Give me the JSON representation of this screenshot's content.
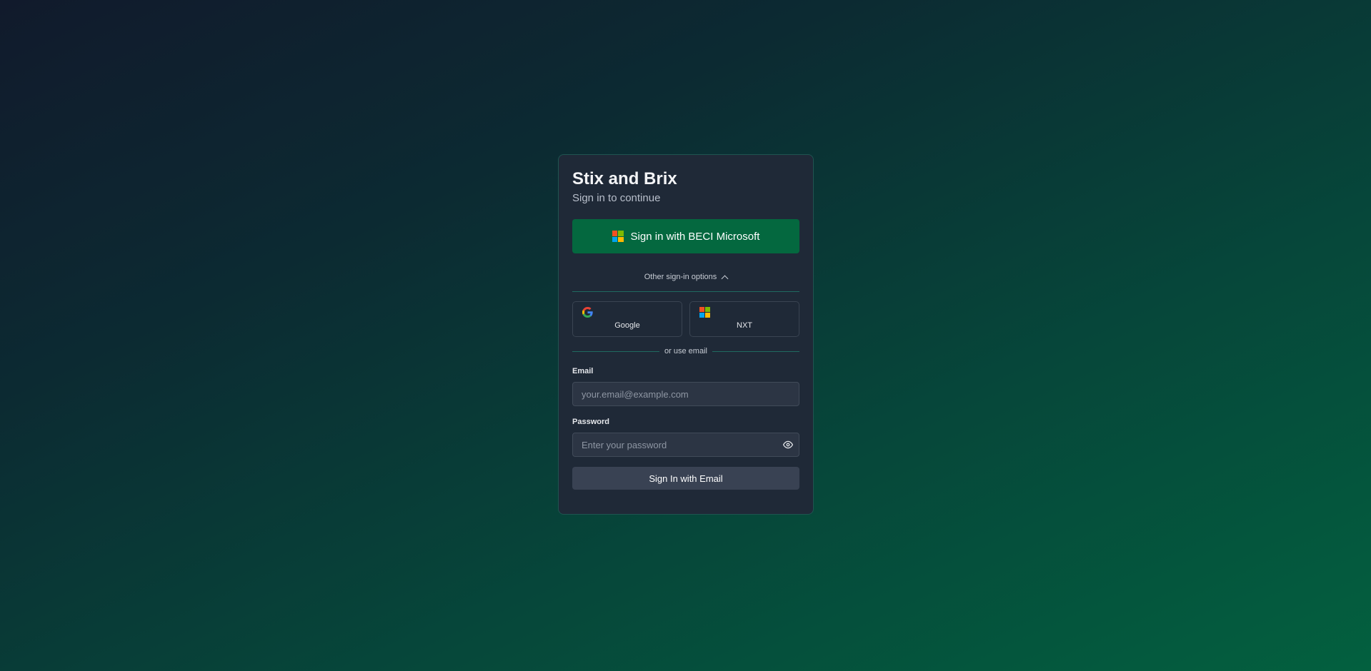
{
  "app": {
    "title": "Stix and Brix",
    "subtitle": "Sign in to continue"
  },
  "primary": {
    "label": "Sign in with BECI Microsoft",
    "icon": "microsoft-logo-icon"
  },
  "other_options": {
    "label": "Other sign-in options",
    "icon": "chevron-up-icon"
  },
  "alt_providers": [
    {
      "label": "Google",
      "icon": "google-logo-icon"
    },
    {
      "label": "NXT",
      "icon": "microsoft-logo-icon"
    }
  ],
  "separator": {
    "label": "or use email"
  },
  "email": {
    "label": "Email",
    "placeholder": "your.email@example.com",
    "value": ""
  },
  "password": {
    "label": "Password",
    "placeholder": "Enter your password",
    "value": "",
    "toggle_icon": "eye-icon"
  },
  "submit": {
    "label": "Sign In with Email"
  },
  "colors": {
    "primary_button": "#04683f",
    "card_background": "#1f2937",
    "card_border": "#1f5450",
    "secondary_button": "#394253",
    "ms_red": "#f25022",
    "ms_green": "#7fba00",
    "ms_blue": "#00a4ef",
    "ms_yellow": "#ffb900"
  }
}
